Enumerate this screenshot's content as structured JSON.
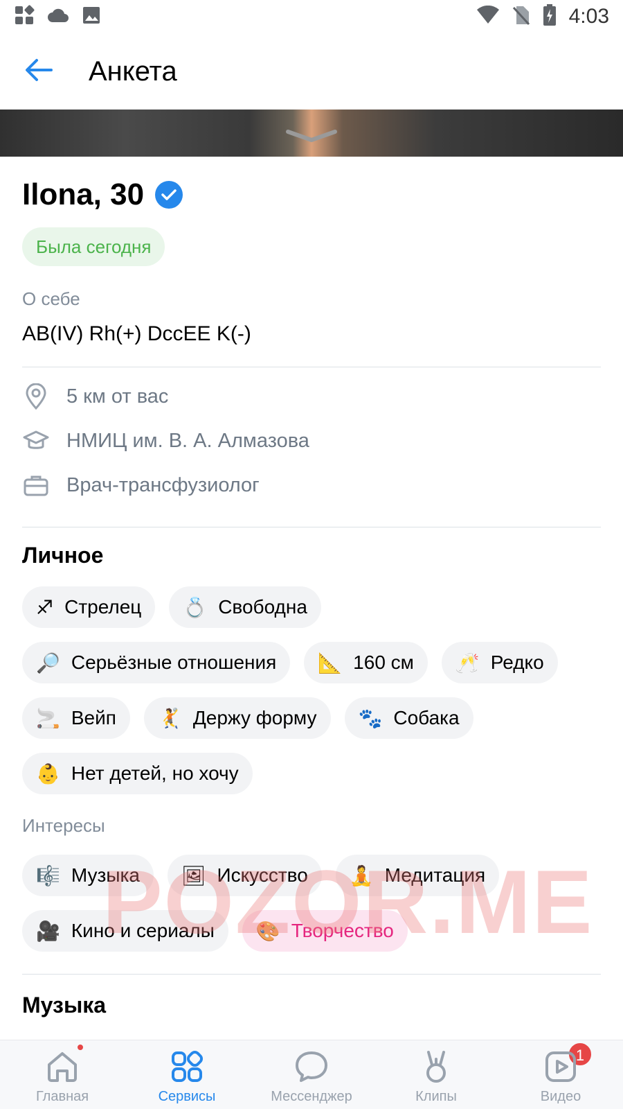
{
  "status_bar": {
    "time": "4:03"
  },
  "header": {
    "title": "Анкета"
  },
  "profile": {
    "name": "Ilona, 30",
    "online_status": "Была сегодня",
    "about_label": "О себе",
    "about_text": "AB(IV) Rh(+) DccEE K(-)",
    "info": {
      "distance": "5 км от вас",
      "education": "НМИЦ им. В. А. Алмазова",
      "job": "Врач-трансфузиолог"
    }
  },
  "personal": {
    "title": "Личное",
    "chips": [
      {
        "emoji": "♐",
        "label": "Стрелец"
      },
      {
        "emoji": "💍",
        "label": "Свободна"
      },
      {
        "emoji": "🔎",
        "label": "Серьёзные отношения"
      },
      {
        "emoji": "📐",
        "label": "160 см"
      },
      {
        "emoji": "🥂",
        "label": "Редко"
      },
      {
        "emoji": "🚬",
        "label": "Вейп"
      },
      {
        "emoji": "🤾",
        "label": "Держу форму"
      },
      {
        "emoji": "🐾",
        "label": "Собака"
      },
      {
        "emoji": "👶",
        "label": "Нет детей, но хочу"
      }
    ]
  },
  "interests": {
    "title": "Интересы",
    "chips": [
      {
        "emoji": "🎼",
        "label": "Музыка"
      },
      {
        "emoji": "🖼",
        "label": "Искусство"
      },
      {
        "emoji": "🧘",
        "label": "Медитация"
      },
      {
        "emoji": "🎥",
        "label": "Кино и сериалы"
      },
      {
        "emoji": "🎨",
        "label": "Творчество"
      }
    ]
  },
  "music_section": {
    "title": "Музыка"
  },
  "watermark": "POZOR.ME",
  "bottom_nav": {
    "items": [
      {
        "label": "Главная"
      },
      {
        "label": "Сервисы"
      },
      {
        "label": "Мессенджер"
      },
      {
        "label": "Клипы"
      },
      {
        "label": "Видео"
      }
    ],
    "messenger_badge": "1"
  },
  "colors": {
    "accent": "#2688eb",
    "online_green": "#4bb34b",
    "badge_red": "#e64646",
    "highlight_pink": "#e5267f"
  }
}
